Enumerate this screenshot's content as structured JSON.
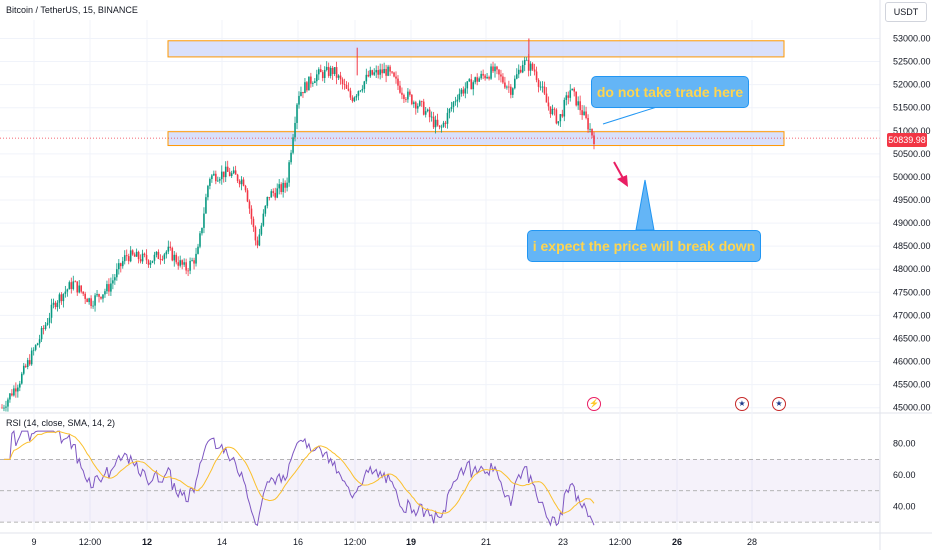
{
  "header": {
    "symbol_line": "Bitcoin / TetherUS, 15, BINANCE",
    "currency": "USDT"
  },
  "rsi_header": "RSI (14, close, SMA, 14, 2)",
  "current_price": "50839.98",
  "annotations": {
    "note1": "do not take trade here",
    "note2": "i expect the price will break down"
  },
  "event_icons": {
    "bolt": "lightning-icon",
    "flags": [
      "us-flag-icon",
      "us-flag-icon"
    ]
  },
  "colors": {
    "up": "#089981",
    "down": "#f23645",
    "zone_fill": "#cfd8fa",
    "zone_border": "#ff9800",
    "rsi_line": "#7e57c2",
    "rsi_ma": "#fbc02d",
    "note_bg": "#64b5f6",
    "note_text": "#ffd54f",
    "arrow": "#e91e63"
  },
  "chart_data": [
    {
      "type": "line",
      "description_type": "candlestick",
      "x_tick_labels": [
        "9",
        "12:00",
        "12",
        "14",
        "16",
        "12:00",
        "19",
        "21",
        "23",
        "12:00",
        "26",
        "28"
      ],
      "y_tick_labels": [
        "53000.00",
        "52500.00",
        "52000.00",
        "51500.00",
        "51000.00",
        "50500.00",
        "50000.00",
        "49500.00",
        "49000.00",
        "48500.00",
        "48000.00",
        "47500.00",
        "47000.00",
        "46500.00",
        "46000.00",
        "45500.00",
        "45000.00"
      ],
      "ylim": [
        44950,
        53400
      ],
      "zones": [
        {
          "from": 52600,
          "to": 52950
        },
        {
          "from": 50680,
          "to": 50980
        }
      ],
      "price_path": [
        {
          "t": 0.0,
          "p": 45000
        },
        {
          "t": 0.03,
          "p": 45600
        },
        {
          "t": 0.06,
          "p": 46400
        },
        {
          "t": 0.09,
          "p": 47300
        },
        {
          "t": 0.12,
          "p": 47700
        },
        {
          "t": 0.15,
          "p": 47300
        },
        {
          "t": 0.18,
          "p": 47600
        },
        {
          "t": 0.21,
          "p": 48300
        },
        {
          "t": 0.25,
          "p": 48200
        },
        {
          "t": 0.28,
          "p": 48400
        },
        {
          "t": 0.31,
          "p": 48000
        },
        {
          "t": 0.33,
          "p": 48300
        },
        {
          "t": 0.35,
          "p": 50000
        },
        {
          "t": 0.38,
          "p": 50100
        },
        {
          "t": 0.41,
          "p": 49900
        },
        {
          "t": 0.43,
          "p": 48500
        },
        {
          "t": 0.45,
          "p": 49600
        },
        {
          "t": 0.48,
          "p": 49800
        },
        {
          "t": 0.5,
          "p": 51800
        },
        {
          "t": 0.53,
          "p": 52200
        },
        {
          "t": 0.56,
          "p": 52300
        },
        {
          "t": 0.59,
          "p": 51700
        },
        {
          "t": 0.62,
          "p": 52200
        },
        {
          "t": 0.65,
          "p": 52300
        },
        {
          "t": 0.68,
          "p": 51800
        },
        {
          "t": 0.71,
          "p": 51500
        },
        {
          "t": 0.74,
          "p": 51000
        },
        {
          "t": 0.77,
          "p": 51800
        },
        {
          "t": 0.8,
          "p": 52100
        },
        {
          "t": 0.83,
          "p": 52300
        },
        {
          "t": 0.86,
          "p": 51900
        },
        {
          "t": 0.88,
          "p": 52500
        },
        {
          "t": 0.9,
          "p": 52300
        },
        {
          "t": 0.92,
          "p": 51600
        },
        {
          "t": 0.94,
          "p": 51200
        },
        {
          "t": 0.96,
          "p": 51900
        },
        {
          "t": 0.98,
          "p": 51400
        },
        {
          "t": 1.0,
          "p": 50840
        }
      ],
      "spike_highs": [
        {
          "t": 0.6,
          "p": 52800
        },
        {
          "t": 0.89,
          "p": 53000
        }
      ],
      "rsi": {
        "y_tick_labels": [
          "80.00",
          "60.00",
          "40.00"
        ],
        "ylim": [
          25,
          90
        ],
        "bands": [
          30,
          50,
          70
        ]
      }
    }
  ]
}
